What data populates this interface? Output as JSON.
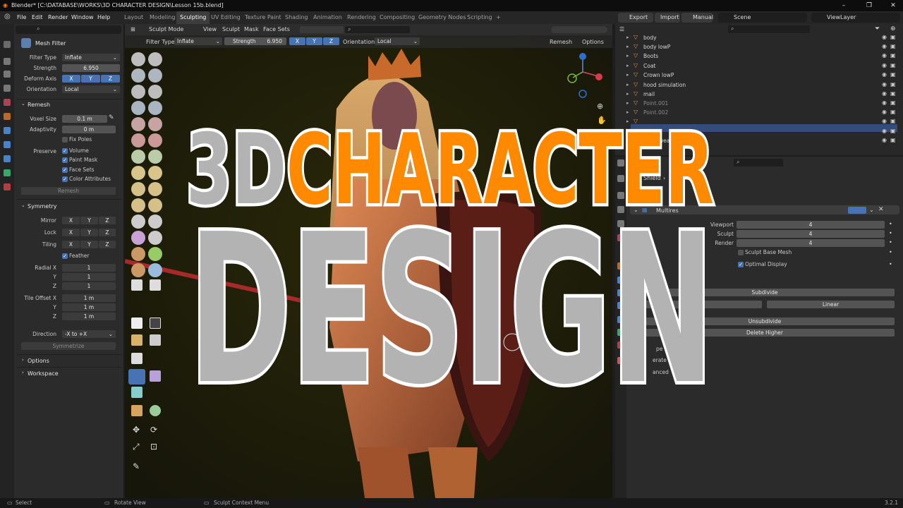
{
  "window": {
    "title": "Blender* [C:\\DATABASE\\WORKS\\3D CHARACTER DESIGN\\Lesson 15b.blend]"
  },
  "menu": [
    "File",
    "Edit",
    "Render",
    "Window",
    "Help"
  ],
  "workspaces": [
    "Layout",
    "Modeling",
    "Sculpting",
    "UV Editing",
    "Texture Paint",
    "Shading",
    "Animation",
    "Rendering",
    "Compositing",
    "Geometry Nodes",
    "Scripting",
    "+"
  ],
  "active_workspace": "Sculpting",
  "topright": {
    "export": "Export",
    "import": "Import",
    "manual": "Manual",
    "scene": "Scene",
    "viewlayer": "ViewLayer"
  },
  "left_panel": {
    "tool_name": "Mesh Filter",
    "filter_type_label": "Filter Type",
    "filter_type_value": "Inflate",
    "strength_label": "Strength",
    "strength_value": "6.950",
    "deform_axis_label": "Deform Axis",
    "axes": [
      "X",
      "Y",
      "Z"
    ],
    "orientation_label": "Orientation",
    "orientation_value": "Local",
    "remesh": {
      "title": "Remesh",
      "voxel_size_label": "Voxel Size",
      "voxel_size_value": "0.1 m",
      "adaptivity_label": "Adaptivity",
      "adaptivity_value": "0 m",
      "fix_poles": "Fix Poles",
      "preserve_label": "Preserve",
      "volume": "Volume",
      "paint_mask": "Paint Mask",
      "face_sets": "Face Sets",
      "color_attributes": "Color Attributes",
      "remesh_button": "Remesh"
    },
    "symmetry": {
      "title": "Symmetry",
      "mirror": "Mirror",
      "lock": "Lock",
      "tiling": "Tiling",
      "feather": "Feather",
      "radial_x": "Radial X",
      "radial_x_value": "1",
      "y": "Y",
      "y_value": "1",
      "z": "Z",
      "z_value": "1",
      "tile_offset_x": "Tile Offset X",
      "tile_offset_x_value": "1 m",
      "tile_y_value": "1 m",
      "tile_z_value": "1 m",
      "direction_label": "Direction",
      "direction_value": "-X to +X",
      "symmetrize": "Symmetrize"
    },
    "options": "Options",
    "workspace": "Workspace"
  },
  "viewport_header": {
    "mode": "Sculpt Mode",
    "menus": [
      "View",
      "Sculpt",
      "Mask",
      "Face Sets"
    ],
    "filter_type_label": "Filter Type:",
    "filter_type_value": "Inflate",
    "strength_label": "Strength",
    "strength_value": "6.950",
    "axes": [
      "X",
      "Y",
      "Z"
    ],
    "orientation_label": "Orientation",
    "orientation_value": "Local",
    "remesh": "Remesh",
    "options": "Options"
  },
  "outliner": {
    "items": [
      "body",
      "body lowP",
      "Boots",
      "Coat",
      "Crown lowP",
      "hood simulation",
      "mail",
      "Point.001",
      "Point.002",
      "",
      "",
      "underwear"
    ]
  },
  "properties": {
    "breadcrumb": "Shield",
    "modifier_name": "Multires",
    "viewport_label": "Viewport",
    "viewport_value": "4",
    "sculpt_label": "Sculpt",
    "sculpt_value": "4",
    "render_label": "Render",
    "render_value": "4",
    "sculpt_base_mesh": "Sculpt Base Mesh",
    "optimal_display": "Optimal Display",
    "subdivide": "Subdivide",
    "linear": "Linear",
    "unsubdivide": "Unsubdivide",
    "delete_higher": "Delete Higher",
    "partial_1": "pe",
    "partial_2": "erate",
    "partial_3": "anced"
  },
  "statusbar": {
    "select": "Select",
    "rotate": "Rotate View",
    "context": "Sculpt Context Menu",
    "version": "3.2.1"
  },
  "overlay": {
    "line1_a": "3D",
    "line1_b": "CHARACTER",
    "line2": "DESIGN"
  },
  "colors": {
    "accent_orange": "#ff8a00",
    "overlay_grey": "#b3b3b3",
    "blender_blue": "#4772b3"
  }
}
